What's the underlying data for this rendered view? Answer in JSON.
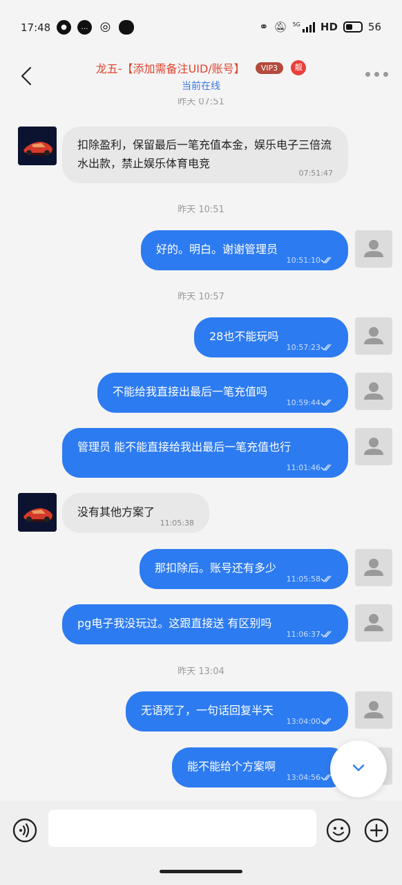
{
  "status_bar": {
    "time": "17:48",
    "network": "5G",
    "hd": "HD",
    "battery": "56"
  },
  "header": {
    "title": "龙五-【添加需备注UID/账号】",
    "vip_badge": "VIP3",
    "hot_badge": "靓",
    "subtitle": "当前在线"
  },
  "messages": [
    {
      "type": "timestamp",
      "text": "昨天 07:51"
    },
    {
      "type": "in",
      "text": "扣除盈利，保留最后一笔充值本金，娱乐电子三倍流水出款，禁止娱乐体育电竞",
      "time": "07:51:47"
    },
    {
      "type": "timestamp",
      "text": "昨天 10:51"
    },
    {
      "type": "out",
      "text": "好的。明白。谢谢管理员",
      "time": "10:51:10"
    },
    {
      "type": "timestamp",
      "text": "昨天 10:57"
    },
    {
      "type": "out",
      "text": "28也不能玩吗",
      "time": "10:57:23"
    },
    {
      "type": "out",
      "text": "不能给我直接出最后一笔充值吗",
      "time": "10:59:44"
    },
    {
      "type": "out",
      "text": "管理员 能不能直接给我出最后一笔充值也行",
      "time": "11:01:46"
    },
    {
      "type": "in",
      "text": "没有其他方案了",
      "time": "11:05:38"
    },
    {
      "type": "out",
      "text": "那扣除后。账号还有多少",
      "time": "11:05:58"
    },
    {
      "type": "out",
      "text": "pg电子我没玩过。这跟直接送 有区别吗",
      "time": "11:06:37"
    },
    {
      "type": "timestamp",
      "text": "昨天 13:04"
    },
    {
      "type": "out",
      "text": "无语死了，一句话回复半天",
      "time": "13:04:00"
    },
    {
      "type": "out",
      "text": "能不能给个方案啊",
      "time": "13:04:56"
    }
  ],
  "input": {
    "placeholder": ""
  },
  "colors": {
    "accent_blue": "#2d7bf0",
    "title_red": "#e0432f",
    "online_blue": "#3a78e0"
  }
}
